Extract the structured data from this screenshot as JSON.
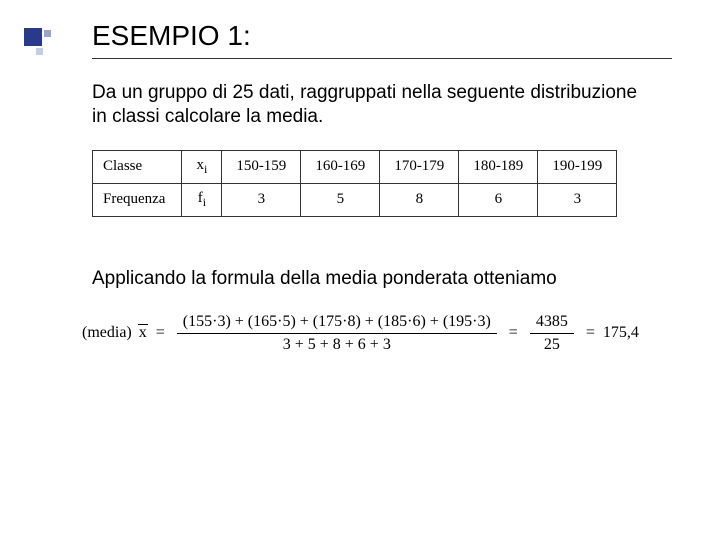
{
  "title": "ESEMPIO 1:",
  "intro": "Da un gruppo di 25 dati, raggruppati nella seguente distribuzione in classi calcolare la media.",
  "table": {
    "row1_label": "Classe",
    "row1_sym_base": "x",
    "row1_sym_sub": "i",
    "row2_label": "Frequenza",
    "row2_sym_base": "f",
    "row2_sym_sub": "i",
    "classes": [
      "150-159",
      "160-169",
      "170-179",
      "180-189",
      "190-199"
    ],
    "freqs": [
      "3",
      "5",
      "8",
      "6",
      "3"
    ]
  },
  "para2": "Applicando la formula della media ponderata otteniamo",
  "formula": {
    "lhs_label": "(media)",
    "lhs_sym": "x",
    "eq": "=",
    "numerator": "(155·3) + (165·5) + (175·8) + (185·6) + (195·3)",
    "denominator": "3 + 5 + 8 + 6 + 3",
    "frac2_num": "4385",
    "frac2_den": "25",
    "result": "175,4"
  }
}
